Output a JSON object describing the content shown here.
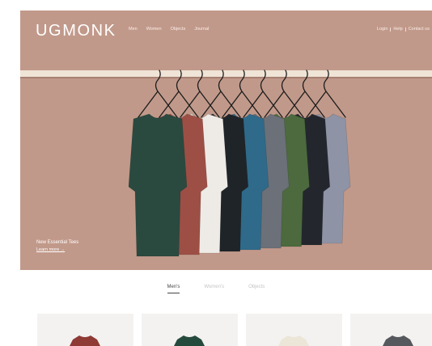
{
  "brand": {
    "logo": "UGMONK"
  },
  "main_nav": [
    "Men",
    "Women",
    "Objects",
    "Journal"
  ],
  "utility_nav": [
    "Login",
    "Help",
    "Contact us"
  ],
  "hero": {
    "title": "New Essential Tees",
    "link": "Learn more →",
    "background_color": "#c1998a",
    "shirt_colors": [
      "#2a4a40",
      "#9d4f45",
      "#eeebe6",
      "#1f2428",
      "#2f6a8a",
      "#6c7078",
      "#4c6a3e",
      "#23272d",
      "#8e93a6"
    ]
  },
  "category_tabs": [
    {
      "label": "Men's",
      "active": true
    },
    {
      "label": "Women's",
      "active": false
    },
    {
      "label": "Objects",
      "active": false
    }
  ],
  "products": [
    {
      "color": "#8f3a35"
    },
    {
      "color": "#244a3d"
    },
    {
      "color": "#ece6d8"
    },
    {
      "color": "#55585c"
    }
  ]
}
